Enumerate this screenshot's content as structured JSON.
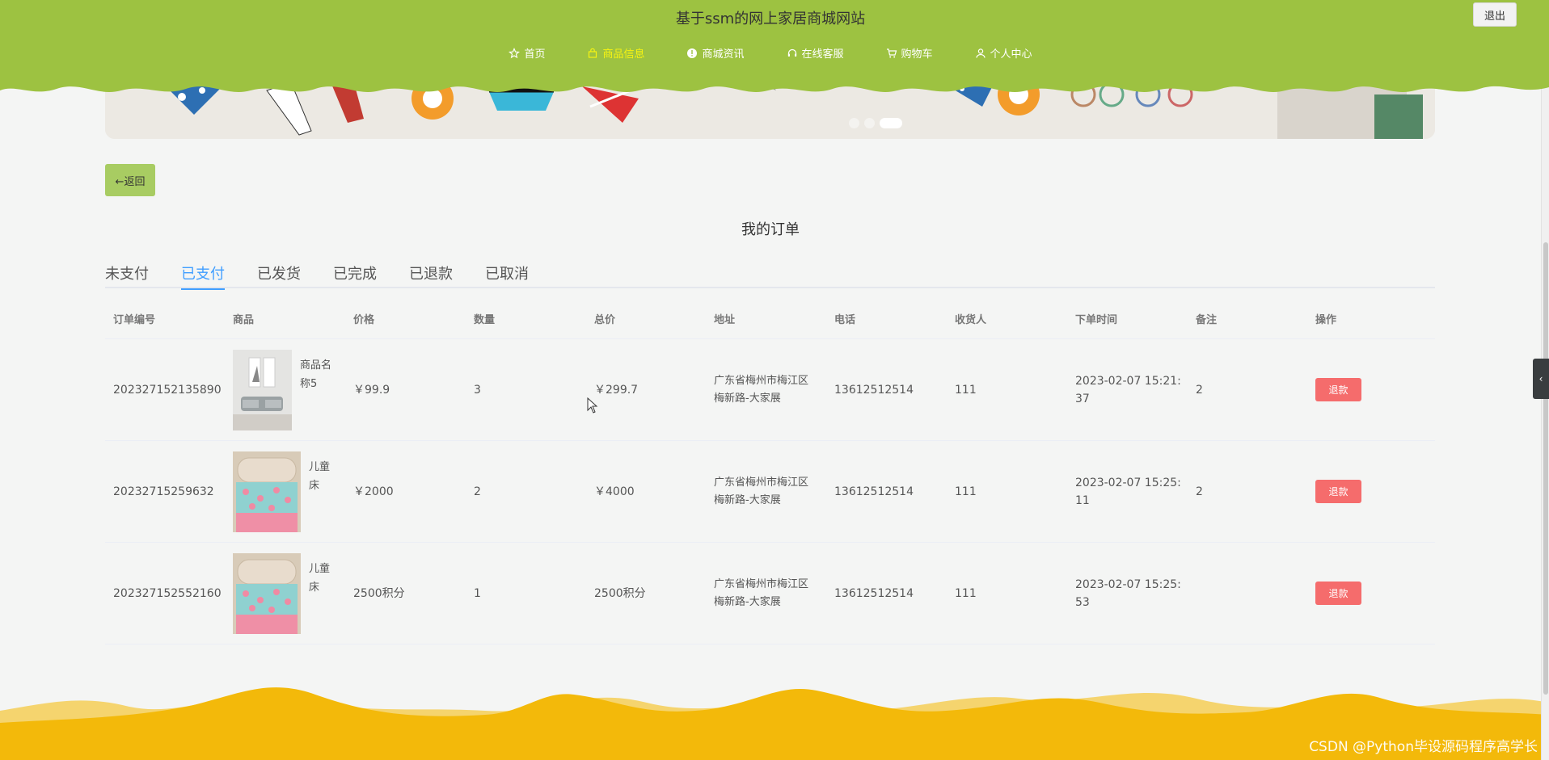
{
  "header": {
    "site_title": "基于ssm的网上家居商城网站",
    "logout_label": "退出",
    "nav": [
      {
        "label": "首页",
        "icon": "star-icon",
        "active": false
      },
      {
        "label": "商品信息",
        "icon": "bag-icon",
        "active": true
      },
      {
        "label": "商城资讯",
        "icon": "info-icon",
        "active": false
      },
      {
        "label": "在线客服",
        "icon": "headset-icon",
        "active": false
      },
      {
        "label": "购物车",
        "icon": "cart-icon",
        "active": false
      },
      {
        "label": "个人中心",
        "icon": "user-icon",
        "active": false
      }
    ],
    "accent_color": "#9dc241",
    "active_nav_color": "#f6f312"
  },
  "banner": {
    "slide_count": 3,
    "active_slide": 3
  },
  "back_label": "←返回",
  "page_title": "我的订单",
  "tabs": [
    {
      "label": "未支付",
      "active": false
    },
    {
      "label": "已支付",
      "active": true
    },
    {
      "label": "已发货",
      "active": false
    },
    {
      "label": "已完成",
      "active": false
    },
    {
      "label": "已退款",
      "active": false
    },
    {
      "label": "已取消",
      "active": false
    }
  ],
  "table": {
    "columns": [
      "订单编号",
      "商品",
      "价格",
      "数量",
      "总价",
      "地址",
      "电话",
      "收货人",
      "下单时间",
      "备注",
      "操作"
    ],
    "rows": [
      {
        "order_no": "202327152135890",
        "goods_name": "商品名称5",
        "goods_line1": "商品名",
        "goods_line2": "称5",
        "price": "￥99.9",
        "qty": "3",
        "total": "￥299.7",
        "addr_line1": "广东省梅州市梅江区",
        "addr_line2": "梅新路-大家展",
        "phone": "13612512514",
        "receiver": "111",
        "time_line1": "2023-02-07 15:21:",
        "time_line2": "37",
        "remark": "2",
        "action": "退款"
      },
      {
        "order_no": "20232715259632",
        "goods_line1": "儿童",
        "goods_line2": "床",
        "price": "￥2000",
        "qty": "2",
        "total": "￥4000",
        "addr_line1": "广东省梅州市梅江区",
        "addr_line2": "梅新路-大家展",
        "phone": "13612512514",
        "receiver": "111",
        "time_line1": "2023-02-07 15:25:",
        "time_line2": "11",
        "remark": "2",
        "action": "退款"
      },
      {
        "order_no": "202327152552160",
        "goods_line1": "儿童",
        "goods_line2": "床",
        "price": "2500积分",
        "qty": "1",
        "total": "2500积分",
        "addr_line1": "广东省梅州市梅江区",
        "addr_line2": "梅新路-大家展",
        "phone": "13612512514",
        "receiver": "111",
        "time_line1": "2023-02-07 15:25:",
        "time_line2": "53",
        "remark": "",
        "action": "退款"
      }
    ]
  },
  "footer": {
    "watermark": "CSDN @Python毕设源码程序高学长",
    "color": "#f3b90a"
  }
}
